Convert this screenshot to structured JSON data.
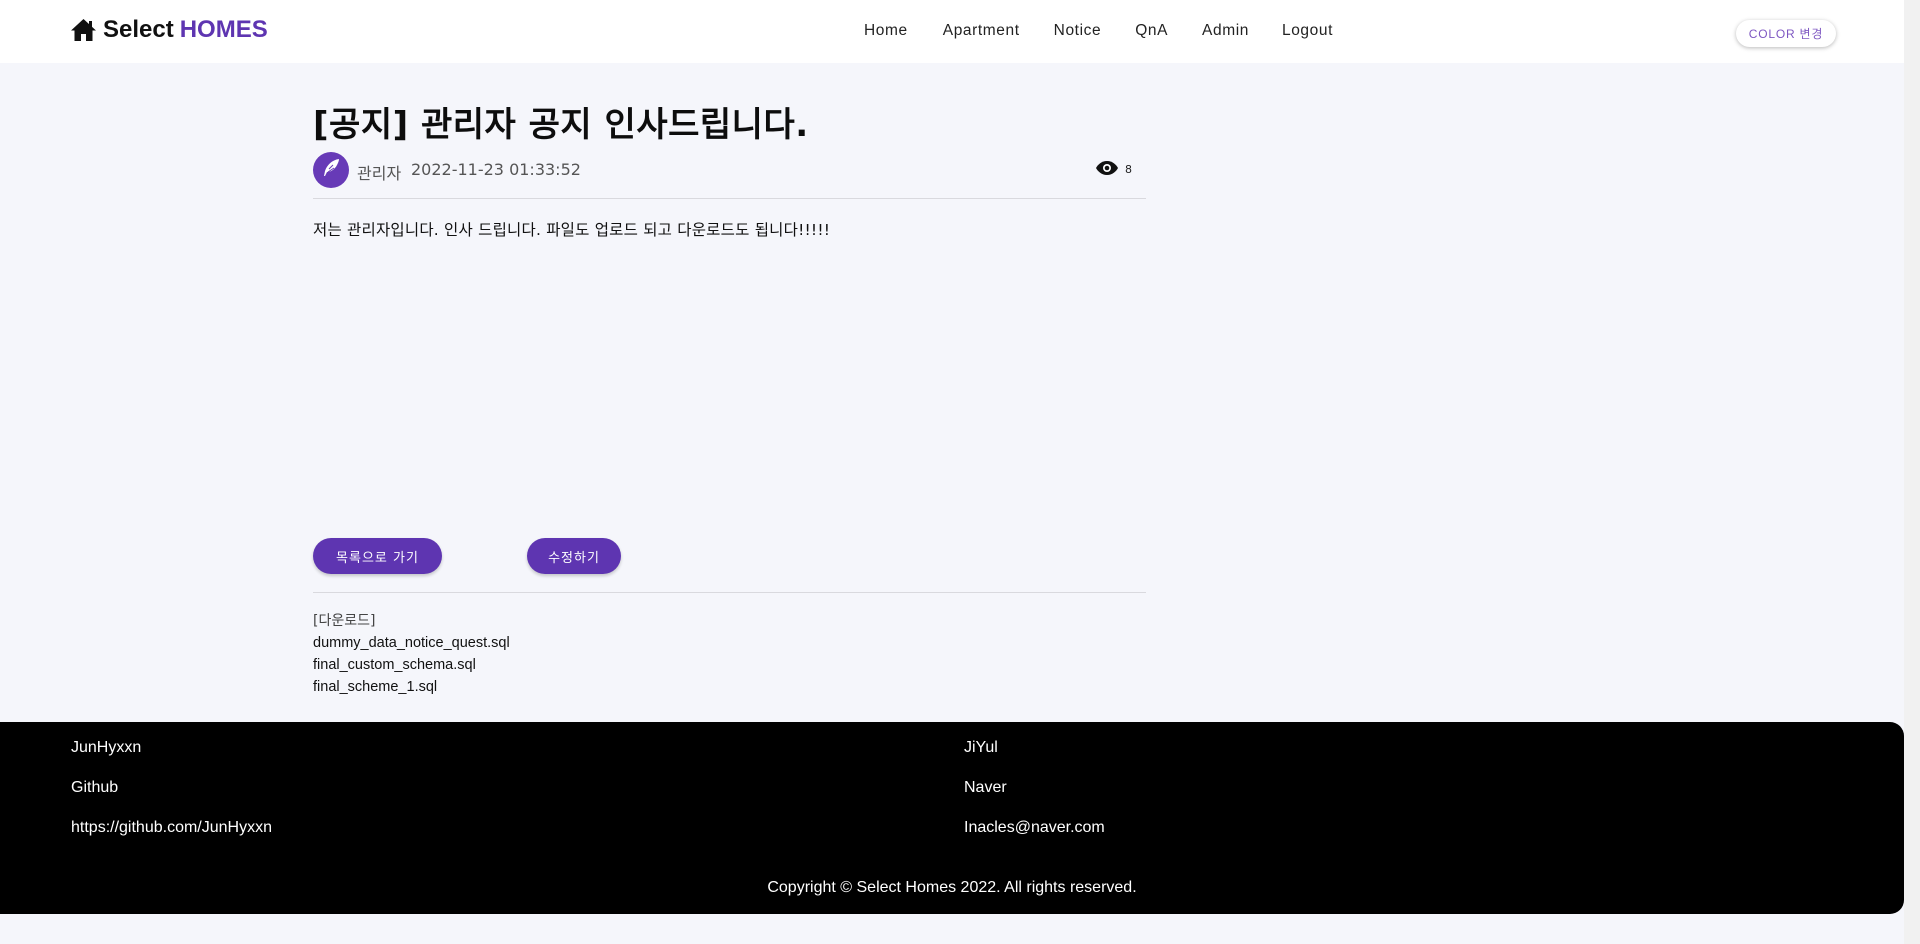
{
  "header": {
    "brand_select": "Select",
    "brand_homes": "HOMES",
    "nav": {
      "home": "Home",
      "apartment": "Apartment",
      "notice": "Notice",
      "qna": "QnA",
      "admin": "Admin",
      "logout": "Logout"
    },
    "color_button": "COLOR 변경"
  },
  "article": {
    "title": "[공지] 관리자 공지 인사드립니다.",
    "author": "관리자",
    "date": "2022-11-23 01:33:52",
    "views": "8",
    "content": "저는 관리자입니다. 인사 드립니다. 파일도 업로드 되고 다운로드도 됩니다!!!!!"
  },
  "actions": {
    "list_button": "목록으로 가기",
    "edit_button": "수정하기"
  },
  "downloads": {
    "title": "[다운로드]",
    "files": [
      "dummy_data_notice_quest.sql",
      "final_custom_schema.sql",
      "final_scheme_1.sql"
    ]
  },
  "footer": {
    "col1": {
      "name": "JunHyxxn",
      "label": "Github",
      "link": "https://github.com/JunHyxxn"
    },
    "col2": {
      "name": "JiYul",
      "label": "Naver",
      "link": "Inacles@naver.com"
    },
    "copyright": "Copyright © Select Homes 2022. All rights reserved."
  },
  "colors": {
    "accent": "#5e35b1",
    "background": "#f5f6fb",
    "footer": "#000000"
  }
}
